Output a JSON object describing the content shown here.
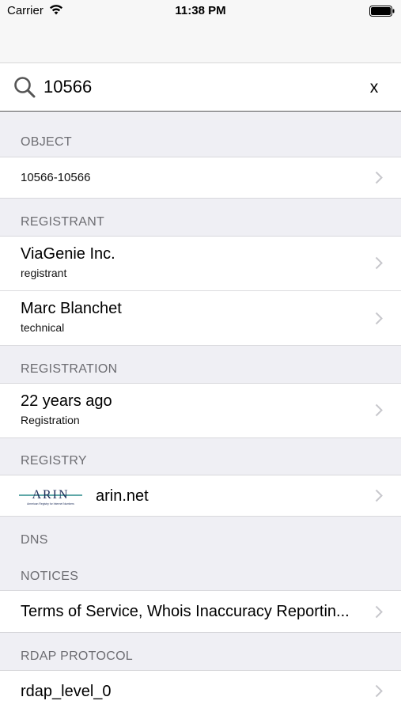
{
  "status_bar": {
    "carrier": "Carrier",
    "time": "11:38 PM"
  },
  "search": {
    "value": "10566",
    "clear_label": "x"
  },
  "sections": {
    "object": {
      "header": "OBJECT",
      "rows": [
        {
          "title": "10566-10566"
        }
      ]
    },
    "registrant": {
      "header": "REGISTRANT",
      "rows": [
        {
          "title": "ViaGenie Inc.",
          "subtitle": "registrant"
        },
        {
          "title": "Marc Blanchet",
          "subtitle": "technical"
        }
      ]
    },
    "registration": {
      "header": "REGISTRATION",
      "rows": [
        {
          "title": "22 years ago",
          "subtitle": "Registration"
        }
      ]
    },
    "registry": {
      "header": "REGISTRY",
      "rows": [
        {
          "logo_text": "ARIN",
          "logo_tagline": "American Registry for Internet Numbers",
          "title": "arin.net"
        }
      ]
    },
    "dns": {
      "header": "DNS"
    },
    "notices": {
      "header": "NOTICES",
      "rows": [
        {
          "title": "Terms of Service, Whois Inaccuracy Reportin..."
        }
      ]
    },
    "rdap_protocol": {
      "header": "RDAP PROTOCOL",
      "rows": [
        {
          "title": "rdap_level_0"
        }
      ]
    }
  },
  "colors": {
    "background": "#efeff4",
    "header_text": "#6d6d72",
    "chevron": "#c7c7cc",
    "logo_teal": "#2a8c8c"
  }
}
